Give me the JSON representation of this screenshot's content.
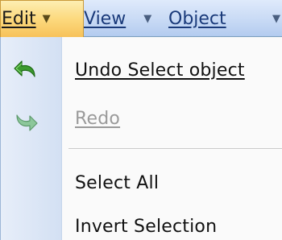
{
  "menubar": {
    "items": [
      {
        "label": "Edit",
        "active": true
      },
      {
        "label": "View",
        "active": false
      },
      {
        "label": "Object",
        "active": false
      }
    ]
  },
  "menu": {
    "items": [
      {
        "label": "Undo Select object",
        "enabled": true,
        "icon": "undo-arrow-icon"
      },
      {
        "label": "Redo",
        "enabled": false,
        "icon": "redo-arrow-icon"
      },
      {
        "label": "Select All",
        "enabled": true
      },
      {
        "label": "Invert Selection",
        "enabled": true
      }
    ]
  },
  "colors": {
    "active_menu": "#fcd97e",
    "menubar": "#c8daf5",
    "icon_green": "#3c9a2e",
    "disabled_text": "#9a9a9a"
  }
}
